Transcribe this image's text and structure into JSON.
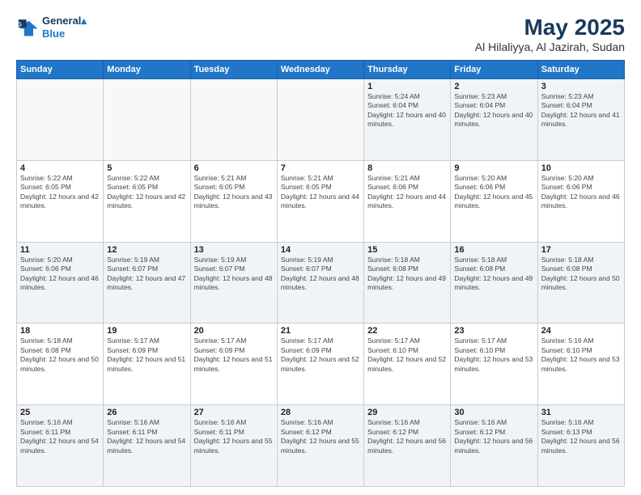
{
  "logo": {
    "line1": "General",
    "line2": "Blue"
  },
  "title": "May 2025",
  "location": "Al Hilaliyya, Al Jazirah, Sudan",
  "days_of_week": [
    "Sunday",
    "Monday",
    "Tuesday",
    "Wednesday",
    "Thursday",
    "Friday",
    "Saturday"
  ],
  "weeks": [
    [
      {
        "day": "",
        "empty": true
      },
      {
        "day": "",
        "empty": true
      },
      {
        "day": "",
        "empty": true
      },
      {
        "day": "",
        "empty": true
      },
      {
        "day": "1",
        "sunrise": "5:24 AM",
        "sunset": "6:04 PM",
        "daylight": "12 hours and 40 minutes."
      },
      {
        "day": "2",
        "sunrise": "5:23 AM",
        "sunset": "6:04 PM",
        "daylight": "12 hours and 40 minutes."
      },
      {
        "day": "3",
        "sunrise": "5:23 AM",
        "sunset": "6:04 PM",
        "daylight": "12 hours and 41 minutes."
      }
    ],
    [
      {
        "day": "4",
        "sunrise": "5:22 AM",
        "sunset": "6:05 PM",
        "daylight": "12 hours and 42 minutes."
      },
      {
        "day": "5",
        "sunrise": "5:22 AM",
        "sunset": "6:05 PM",
        "daylight": "12 hours and 42 minutes."
      },
      {
        "day": "6",
        "sunrise": "5:21 AM",
        "sunset": "6:05 PM",
        "daylight": "12 hours and 43 minutes."
      },
      {
        "day": "7",
        "sunrise": "5:21 AM",
        "sunset": "6:05 PM",
        "daylight": "12 hours and 44 minutes."
      },
      {
        "day": "8",
        "sunrise": "5:21 AM",
        "sunset": "6:06 PM",
        "daylight": "12 hours and 44 minutes."
      },
      {
        "day": "9",
        "sunrise": "5:20 AM",
        "sunset": "6:06 PM",
        "daylight": "12 hours and 45 minutes."
      },
      {
        "day": "10",
        "sunrise": "5:20 AM",
        "sunset": "6:06 PM",
        "daylight": "12 hours and 46 minutes."
      }
    ],
    [
      {
        "day": "11",
        "sunrise": "5:20 AM",
        "sunset": "6:06 PM",
        "daylight": "12 hours and 46 minutes."
      },
      {
        "day": "12",
        "sunrise": "5:19 AM",
        "sunset": "6:07 PM",
        "daylight": "12 hours and 47 minutes."
      },
      {
        "day": "13",
        "sunrise": "5:19 AM",
        "sunset": "6:07 PM",
        "daylight": "12 hours and 48 minutes."
      },
      {
        "day": "14",
        "sunrise": "5:19 AM",
        "sunset": "6:07 PM",
        "daylight": "12 hours and 48 minutes."
      },
      {
        "day": "15",
        "sunrise": "5:18 AM",
        "sunset": "6:08 PM",
        "daylight": "12 hours and 49 minutes."
      },
      {
        "day": "16",
        "sunrise": "5:18 AM",
        "sunset": "6:08 PM",
        "daylight": "12 hours and 49 minutes."
      },
      {
        "day": "17",
        "sunrise": "5:18 AM",
        "sunset": "6:08 PM",
        "daylight": "12 hours and 50 minutes."
      }
    ],
    [
      {
        "day": "18",
        "sunrise": "5:18 AM",
        "sunset": "6:08 PM",
        "daylight": "12 hours and 50 minutes."
      },
      {
        "day": "19",
        "sunrise": "5:17 AM",
        "sunset": "6:09 PM",
        "daylight": "12 hours and 51 minutes."
      },
      {
        "day": "20",
        "sunrise": "5:17 AM",
        "sunset": "6:09 PM",
        "daylight": "12 hours and 51 minutes."
      },
      {
        "day": "21",
        "sunrise": "5:17 AM",
        "sunset": "6:09 PM",
        "daylight": "12 hours and 52 minutes."
      },
      {
        "day": "22",
        "sunrise": "5:17 AM",
        "sunset": "6:10 PM",
        "daylight": "12 hours and 52 minutes."
      },
      {
        "day": "23",
        "sunrise": "5:17 AM",
        "sunset": "6:10 PM",
        "daylight": "12 hours and 53 minutes."
      },
      {
        "day": "24",
        "sunrise": "5:16 AM",
        "sunset": "6:10 PM",
        "daylight": "12 hours and 53 minutes."
      }
    ],
    [
      {
        "day": "25",
        "sunrise": "5:16 AM",
        "sunset": "6:11 PM",
        "daylight": "12 hours and 54 minutes."
      },
      {
        "day": "26",
        "sunrise": "5:16 AM",
        "sunset": "6:11 PM",
        "daylight": "12 hours and 54 minutes."
      },
      {
        "day": "27",
        "sunrise": "5:16 AM",
        "sunset": "6:11 PM",
        "daylight": "12 hours and 55 minutes."
      },
      {
        "day": "28",
        "sunrise": "5:16 AM",
        "sunset": "6:12 PM",
        "daylight": "12 hours and 55 minutes."
      },
      {
        "day": "29",
        "sunrise": "5:16 AM",
        "sunset": "6:12 PM",
        "daylight": "12 hours and 56 minutes."
      },
      {
        "day": "30",
        "sunrise": "5:16 AM",
        "sunset": "6:12 PM",
        "daylight": "12 hours and 56 minutes."
      },
      {
        "day": "31",
        "sunrise": "5:16 AM",
        "sunset": "6:13 PM",
        "daylight": "12 hours and 56 minutes."
      }
    ]
  ]
}
